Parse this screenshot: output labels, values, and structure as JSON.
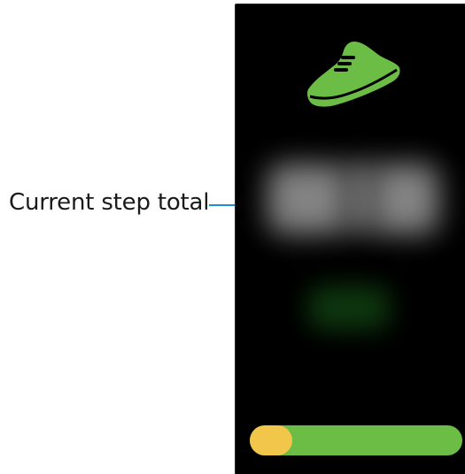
{
  "callout": {
    "label": "Current step total"
  },
  "screen": {
    "icon": "shoe-icon",
    "progress": {
      "fraction": 0.2
    }
  },
  "colors": {
    "screen_background": "#000000",
    "shoe": "#6cbd45",
    "progress_track": "#6cbd45",
    "progress_indicator": "#f1c64a",
    "callout_line": "#1e8fd0"
  }
}
